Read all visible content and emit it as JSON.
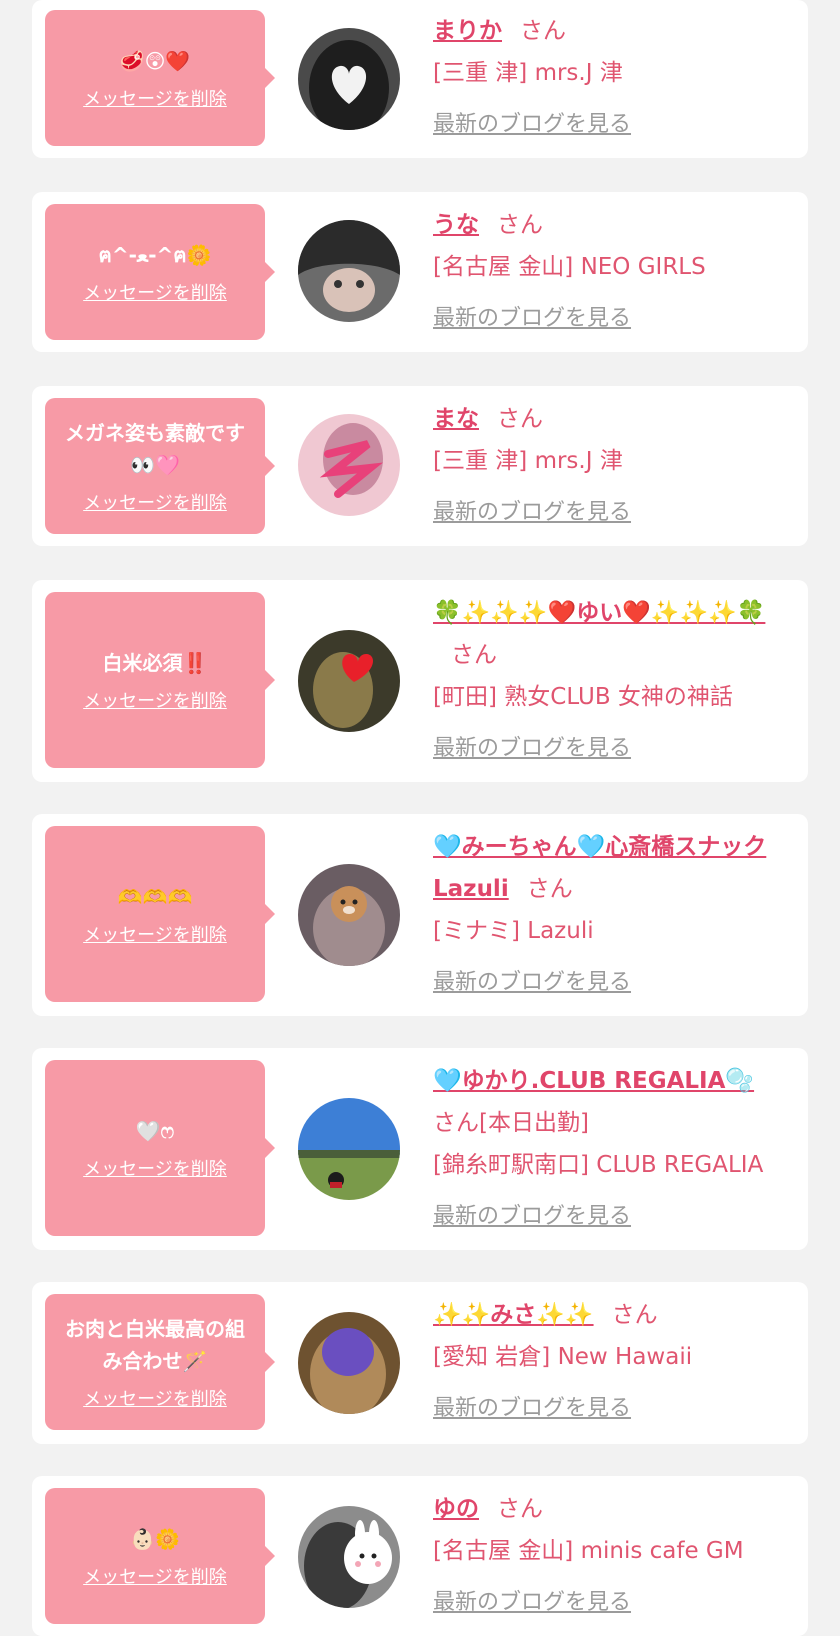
{
  "delete_label": "メッセージを削除",
  "blog_label": "最新のブログを見る",
  "san_label": "さん",
  "colors": {
    "bubble": "#f79aa6",
    "accent": "#e0456a",
    "link_gray": "#9b9b9b",
    "background": "#f2f2f2"
  },
  "entries": [
    {
      "message": "🥩😲❤️",
      "name": "まりか",
      "suffix": "",
      "shop": "[三重 津] mrs.J 津"
    },
    {
      "message": "ฅ^-ﻌ-^ฅ🌼",
      "name": "うな",
      "suffix": "",
      "shop": "[名古屋 金山] NEO GIRLS"
    },
    {
      "message": "メガネ姿も素敵です👀🩷",
      "name": "まな",
      "suffix": "",
      "shop": "[三重 津] mrs.J 津"
    },
    {
      "message": "白米必須‼️",
      "name": "🍀✨✨✨❤️ゆい❤️✨✨✨🍀",
      "suffix": "",
      "shop": "[町田] 熟女CLUB 女神の神話"
    },
    {
      "message": "🫶🫶🫶",
      "name": "🩵みーちゃん🩵心斎橋スナックLazuli",
      "suffix": "",
      "shop": "[ミナミ] Lazuli"
    },
    {
      "message": "🤍ෆ",
      "name": "🩵ゆかり.CLUB REGALIA🫧",
      "suffix": "[本日出勤]",
      "shop": "[錦糸町駅南口] CLUB REGALIA"
    },
    {
      "message": "お肉と白米最高の組み合わせ🪄",
      "name": "✨✨みさ✨✨",
      "suffix": "",
      "shop": "[愛知 岩倉] New Hawaii"
    },
    {
      "message": "👶🏻🌼",
      "name": "ゆの",
      "suffix": "",
      "shop": "[名古屋 金山] minis cafe GM"
    }
  ]
}
